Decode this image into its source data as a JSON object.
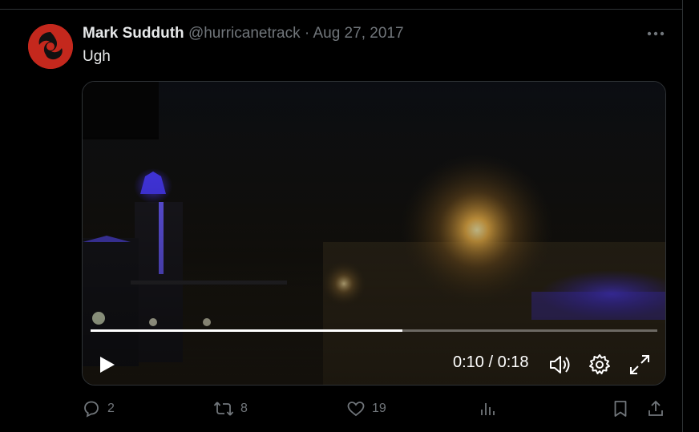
{
  "tweet": {
    "author_name": "Mark Sudduth",
    "handle": "@hurricanetrack",
    "separator": "·",
    "date": "Aug 27, 2017",
    "text": "Ugh"
  },
  "video": {
    "current_time": "0:10",
    "time_separator": " / ",
    "duration": "0:18",
    "progress": 0.55
  },
  "actions": {
    "replies": "2",
    "reposts": "8",
    "likes": "19"
  },
  "colors": {
    "background": "#000000",
    "text": "#e7e9ea",
    "muted": "#71767b",
    "avatar_red": "#c4281d"
  },
  "icons": [
    "more-icon",
    "play-icon",
    "volume-icon",
    "settings-icon",
    "fullscreen-icon",
    "reply-icon",
    "repost-icon",
    "like-icon",
    "views-icon",
    "bookmark-icon",
    "share-icon"
  ]
}
